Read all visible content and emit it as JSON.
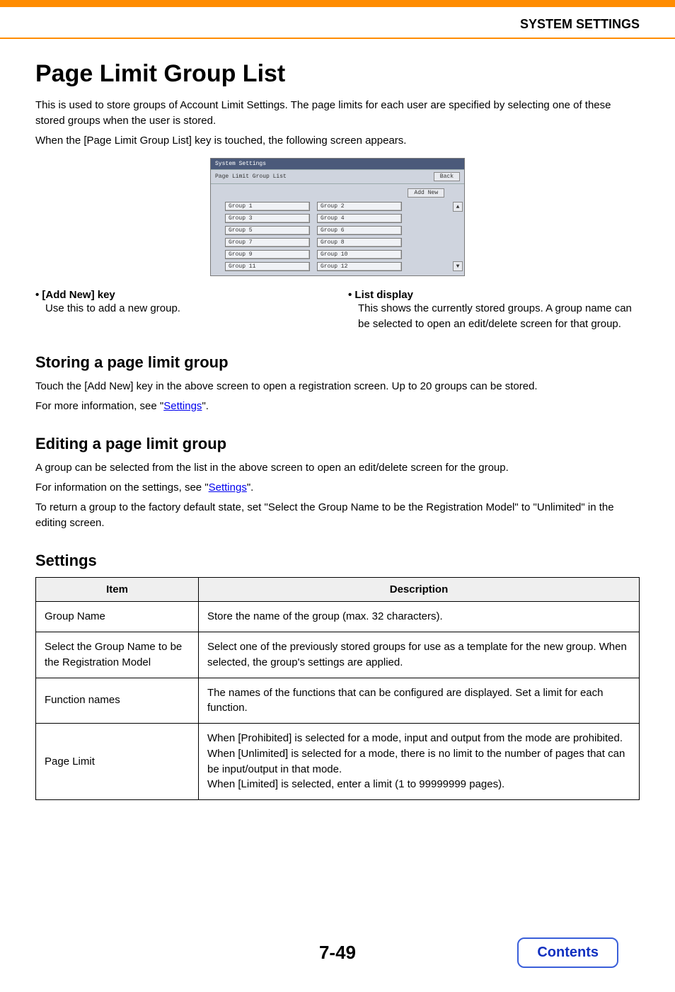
{
  "header": {
    "section": "SYSTEM SETTINGS"
  },
  "title": "Page Limit Group List",
  "intro1": "This is used to store groups of Account Limit Settings. The page limits for each user are specified by selecting one of these stored groups when the user is stored.",
  "intro2": "When the [Page Limit Group List] key is touched, the following screen appears.",
  "ui": {
    "title": "System Settings",
    "subtitle": "Page Limit Group List",
    "back": "Back",
    "addnew": "Add New",
    "left": [
      "Group 1",
      "Group 3",
      "Group 5",
      "Group 7",
      "Group 9",
      "Group 11"
    ],
    "right": [
      "Group 2",
      "Group 4",
      "Group 6",
      "Group 8",
      "Group 10",
      "Group 12"
    ]
  },
  "bullets": {
    "left_head": "• [Add New] key",
    "left_text": "Use this to add a new group.",
    "right_head": "• List display",
    "right_text": "This shows the currently stored groups. A group name can be selected to open an edit/delete screen for that group."
  },
  "storing": {
    "heading": "Storing a page limit group",
    "p1": "Touch the [Add New] key in the above screen to open a registration screen. Up to 20 groups can be stored.",
    "p2a": "For more information, see \"",
    "link": "Settings",
    "p2b": "\"."
  },
  "editing": {
    "heading": "Editing a page limit group",
    "p1": "A group can be selected from the list in the above screen to open an edit/delete screen for the group.",
    "p2a": "For information on the settings, see \"",
    "link": "Settings",
    "p2b": "\".",
    "p3": "To return a group to the factory default state, set \"Select the Group Name to be the Registration Model\" to \"Unlimited\" in the editing screen."
  },
  "settings": {
    "heading": "Settings",
    "cols": {
      "item": "Item",
      "desc": "Description"
    },
    "rows": [
      {
        "item": "Group Name",
        "desc": "Store the name of the group (max. 32 characters)."
      },
      {
        "item": "Select the Group Name to be the Registration Model",
        "desc": "Select one of the previously stored groups for use as a template for the new group. When selected, the group's settings are applied."
      },
      {
        "item": "Function names",
        "desc": "The names of the functions that can be configured are displayed. Set a limit for each function."
      },
      {
        "item": "Page Limit",
        "desc": "When [Prohibited] is selected for a mode, input and output from the mode are prohibited.\nWhen [Unlimited] is selected for a mode, there is no limit to the number of pages that can be input/output in that mode.\nWhen [Limited] is selected, enter a limit (1 to 99999999 pages)."
      }
    ]
  },
  "footer": {
    "page": "7-49",
    "contents": "Contents"
  }
}
